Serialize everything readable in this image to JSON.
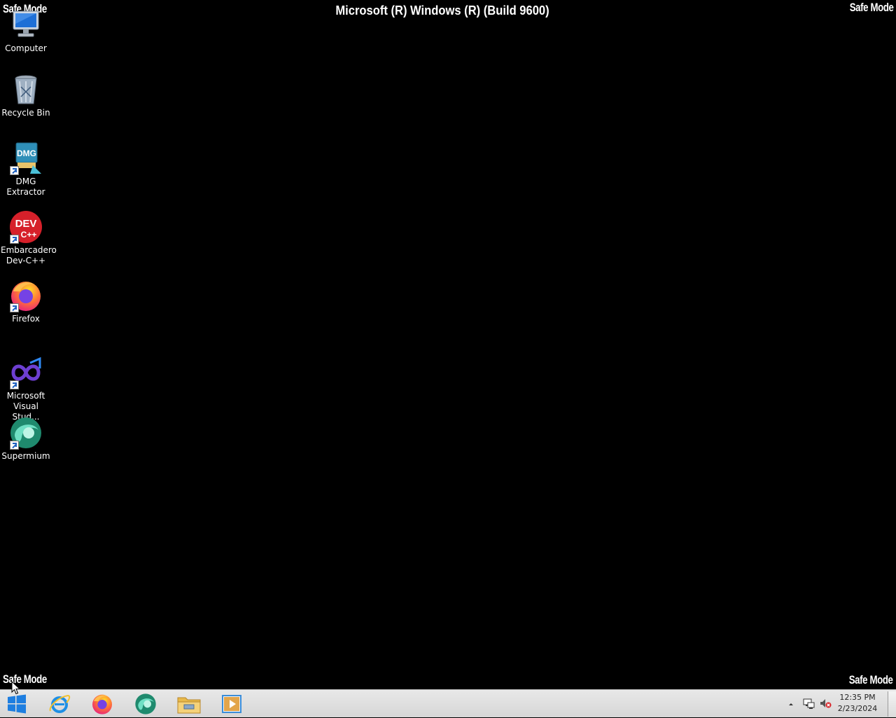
{
  "watermarks": {
    "top_left": "Safe Mode",
    "top_right": "Safe Mode",
    "bottom_left": "Safe Mode",
    "bottom_right": "Safe Mode"
  },
  "build_title": "Microsoft (R) Windows (R) (Build 9600)",
  "desktop_icons": [
    {
      "label": "Computer",
      "icon": "computer-icon"
    },
    {
      "label": "Recycle Bin",
      "icon": "recycle-bin-icon"
    },
    {
      "label": "DMG Extractor",
      "icon": "dmg-extractor-icon",
      "shortcut": true
    },
    {
      "label": "Embarcadero Dev-C++",
      "icon": "dev-cpp-icon",
      "shortcut": true
    },
    {
      "label": "Firefox",
      "icon": "firefox-icon",
      "shortcut": true
    },
    {
      "label": "Microsoft Visual Stud...",
      "icon": "visual-studio-icon",
      "shortcut": true
    },
    {
      "label": "Supermium",
      "icon": "supermium-icon",
      "shortcut": true
    }
  ],
  "dmg_badge": "DMG",
  "dev_badge": "DEV",
  "dev_badge_sub": "C++",
  "taskbar": {
    "pinned": [
      {
        "name": "internet-explorer",
        "icon": "internet-explorer-icon"
      },
      {
        "name": "firefox",
        "icon": "firefox-icon"
      },
      {
        "name": "supermium",
        "icon": "supermium-icon"
      },
      {
        "name": "file-explorer",
        "icon": "folder-icon"
      },
      {
        "name": "media-player",
        "icon": "media-player-icon"
      }
    ],
    "tray": {
      "overflow_icon": "chevron-up-icon",
      "network_icon": "network-icon",
      "volume_icon": "volume-muted-icon"
    },
    "clock": {
      "time": "12:35 PM",
      "date": "2/23/2024"
    }
  },
  "colors": {
    "desktop_background": "#000000",
    "taskbar_background": "#dcdcdc",
    "text": "#ffffff"
  }
}
